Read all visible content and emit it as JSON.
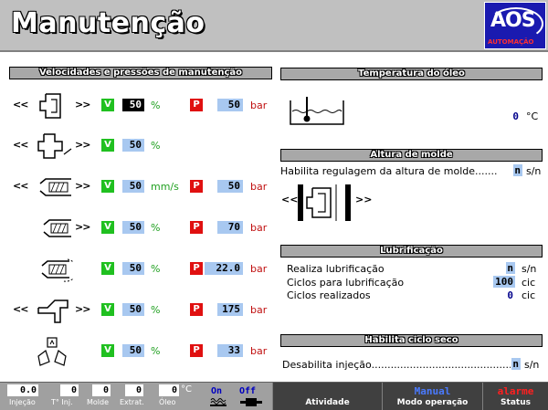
{
  "header": {
    "title": "Manutenção",
    "logo_text": "AOS",
    "logo_subtext": "AUTOMAÇÃO"
  },
  "left_panel": {
    "title": "Velocidades e pressões de manutenção",
    "rows": [
      {
        "left_arrows": "<<",
        "right_arrows": ">>",
        "v_label": "V",
        "v_value": "50",
        "v_unit": "%",
        "p_label": "P",
        "p_value": "50",
        "p_unit": "bar"
      },
      {
        "left_arrows": "<<",
        "right_arrows": ">>",
        "v_label": "V",
        "v_value": "50",
        "v_unit": "%"
      },
      {
        "left_arrows": "<<",
        "right_arrows": ">>",
        "v_label": "V",
        "v_value": "50",
        "v_unit": "mm/s",
        "p_label": "P",
        "p_value": "50",
        "p_unit": "bar"
      },
      {
        "right_arrows": ">>",
        "v_label": "V",
        "v_value": "50",
        "v_unit": "%",
        "p_label": "P",
        "p_value": "70",
        "p_unit": "bar"
      },
      {
        "v_label": "V",
        "v_value": "50",
        "v_unit": "%",
        "p_label": "P",
        "p_value": "22.0",
        "p_unit": "bar"
      },
      {
        "left_arrows": "<<",
        "right_arrows": ">>",
        "v_label": "V",
        "v_value": "50",
        "v_unit": "%",
        "p_label": "P",
        "p_value": "175",
        "p_unit": "bar"
      },
      {
        "v_label": "V",
        "v_value": "50",
        "v_unit": "%",
        "p_label": "P",
        "p_value": "33",
        "p_unit": "bar"
      }
    ]
  },
  "oil_temp": {
    "title": "Temperatura do óleo",
    "value": "0",
    "unit": "°C"
  },
  "mold_height": {
    "title": "Altura de molde",
    "enable_label": "Habilita regulagem da altura de molde.......",
    "enable_value": "n",
    "enable_unit": "s/n",
    "left_arrows": "<<",
    "right_arrows": ">>"
  },
  "lubrication": {
    "title": "Lubrificação",
    "items": [
      {
        "label": "Realiza lubrificação",
        "value": "n",
        "unit": "s/n"
      },
      {
        "label": "Ciclos para lubrificação",
        "value": "100",
        "unit": "cic"
      },
      {
        "label": "Ciclos realizados",
        "value": "0",
        "unit": "cic"
      }
    ]
  },
  "dry_cycle": {
    "title": "Habilita ciclo seco",
    "label": "Desabilita injeção.................................................",
    "value": "n",
    "unit": "s/n"
  },
  "footer": {
    "injecao": {
      "value": "0.0",
      "label": "Injeção"
    },
    "tinj": {
      "value": "0",
      "label": "T° Inj."
    },
    "molde": {
      "value": "0",
      "label": "Molde"
    },
    "extrat": {
      "value": "0",
      "label": "Extrat."
    },
    "oleo": {
      "value": "0",
      "unit": "°C",
      "label": "Óleo"
    },
    "heater": {
      "state": "On"
    },
    "motor": {
      "state": "Off"
    },
    "atividade": {
      "value": "",
      "label": "Atividade"
    },
    "modo_operacao": {
      "value": "Manual",
      "label": "Modo operação"
    },
    "status": {
      "value": "alarme",
      "label": "Status"
    }
  },
  "colors": {
    "v_badge": "#20c020",
    "p_badge": "#e01010",
    "value_field": "#a8c8f0",
    "section_bar": "#a8a8a8",
    "logo_bg": "#1a1ab0",
    "status_alarm": "#ff2020",
    "mode_manual": "#4a7aff"
  }
}
